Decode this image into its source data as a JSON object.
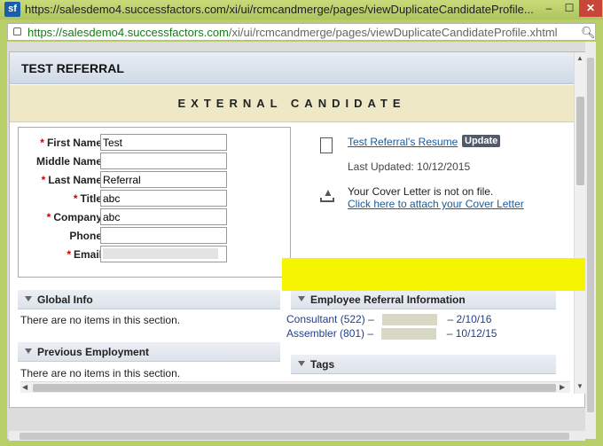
{
  "browser": {
    "title_url": "https://salesdemo4.successfactors.com/xi/ui/rcmcandmerge/pages/viewDuplicateCandidateProfile...",
    "address_host": "https://salesdemo4.successfactors.com",
    "address_path": "/xi/ui/rcmcandmerge/pages/viewDuplicateCandidateProfile.xhtml",
    "logo_text": "sf",
    "min_label": "–",
    "max_label": "☐",
    "close_label": "✕"
  },
  "dialog": {
    "title": "TEST REFERRAL",
    "banner": "EXTERNAL CANDIDATE"
  },
  "form": {
    "fields": [
      {
        "label": "First Name:",
        "required": "*",
        "value": "Test"
      },
      {
        "label": "Middle Name:",
        "required": "",
        "value": ""
      },
      {
        "label": "Last Name:",
        "required": "*",
        "value": "Referral"
      },
      {
        "label": "Title:",
        "required": "*",
        "value": "abc"
      },
      {
        "label": "Company:",
        "required": "*",
        "value": "abc"
      },
      {
        "label": "Phone:",
        "required": "",
        "value": ""
      },
      {
        "label": "Email:",
        "required": "*",
        "value": ""
      }
    ]
  },
  "resume": {
    "link": "Test Referral's Resume",
    "update_label": "Update",
    "last_updated": "Last Updated: 10/12/2015",
    "cover_msg": "Your Cover Letter is not on file.",
    "cover_link": "Click here to attach your Cover Letter"
  },
  "sections": {
    "global_info": {
      "title": "Global Info",
      "empty": "There are no items in this section."
    },
    "previous_employment": {
      "title": "Previous Employment",
      "empty": "There are no items in this section."
    },
    "employee_referral": {
      "title": "Employee Referral Information"
    },
    "tags": {
      "title": "Tags"
    }
  },
  "referrals": [
    {
      "position": "Consultant (522)",
      "dash": "–",
      "date": "– 2/10/16"
    },
    {
      "position": "Assembler (801)",
      "dash": "–",
      "date": "– 10/12/15"
    }
  ],
  "colors": {
    "highlight": "#f6f400",
    "link": "#1a5a99",
    "required": "#cc0000"
  }
}
